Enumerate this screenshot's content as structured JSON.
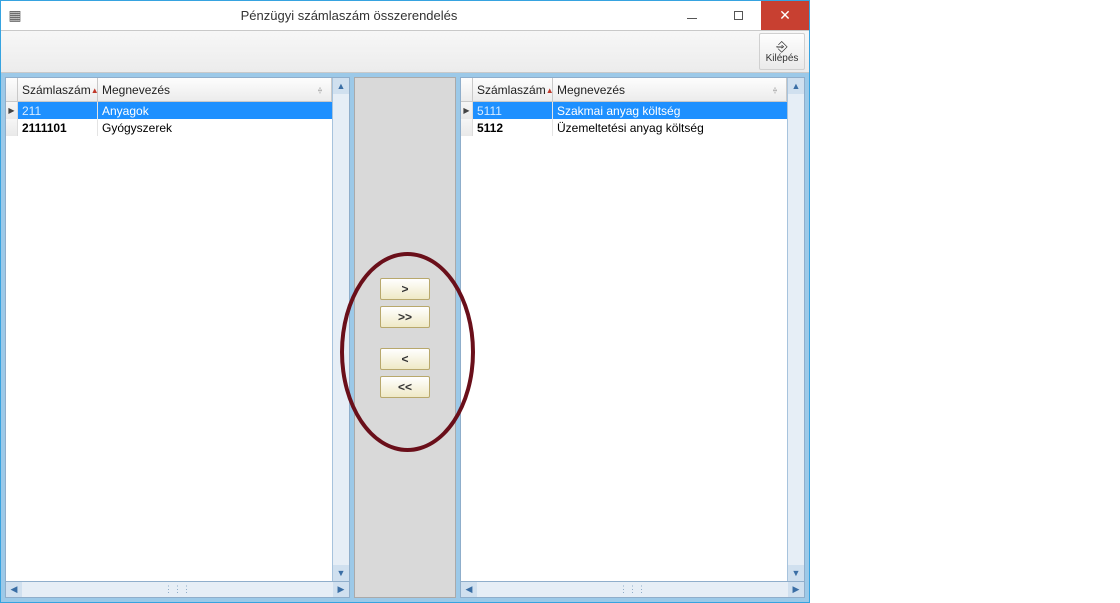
{
  "window": {
    "title": "Pénzügyi számlaszám összerendelés"
  },
  "toolbar": {
    "exit_label": "Kilépés"
  },
  "headers": {
    "col1": "Számlaszám",
    "col2": "Megnevezés"
  },
  "left_rows": [
    {
      "num": "211",
      "name": "Anyagok",
      "selected": true
    },
    {
      "num": "2111101",
      "name": "Gyógyszerek",
      "selected": false
    }
  ],
  "right_rows": [
    {
      "num": "5111",
      "name": "Szakmai anyag költség",
      "selected": true
    },
    {
      "num": "5112",
      "name": "Üzemeltetési anyag költség",
      "selected": false
    }
  ],
  "transfer": {
    "add_one": ">",
    "add_all": ">>",
    "remove_one": "<",
    "remove_all": "<<"
  }
}
